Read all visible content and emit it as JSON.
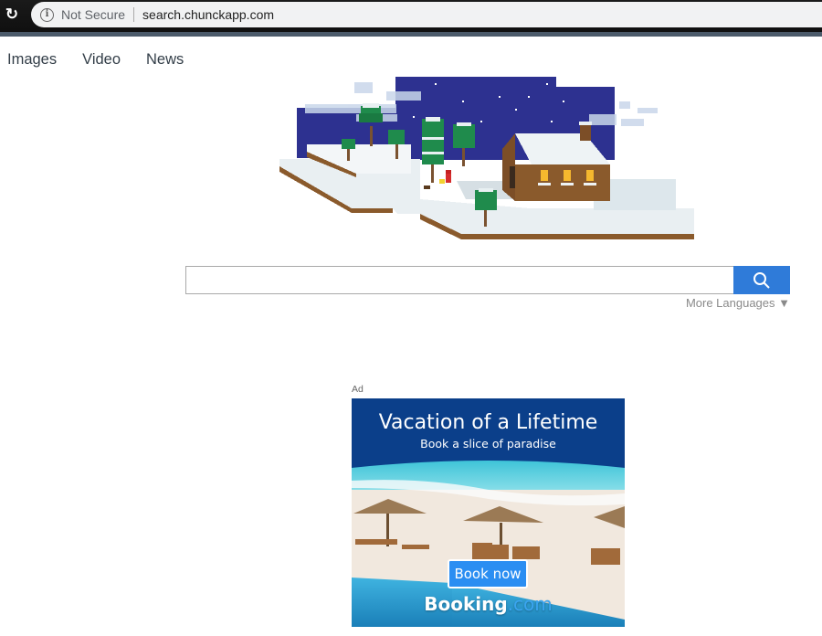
{
  "browser": {
    "reload_icon": "reload-icon",
    "security_icon": "info-icon",
    "security_label": "Not Secure",
    "url": "search.chunckapp.com"
  },
  "nav": {
    "items": [
      {
        "label": "Images"
      },
      {
        "label": "Video"
      },
      {
        "label": "News"
      }
    ]
  },
  "hero": {
    "illustration": "pixel-art winter cabin scene"
  },
  "search": {
    "value": "",
    "placeholder": "",
    "button_icon": "search-icon",
    "more_languages": "More Languages ▼"
  },
  "ad": {
    "label": "Ad",
    "title": "Vacation of a Lifetime",
    "subtitle": "Book a slice of paradise",
    "cta": "Book now",
    "brand_main": "Booking",
    "brand_suffix": ".com"
  },
  "colors": {
    "search_button": "#2f7bd9",
    "ad_background": "#0b3f8a",
    "night_sky": "#2d3190"
  }
}
